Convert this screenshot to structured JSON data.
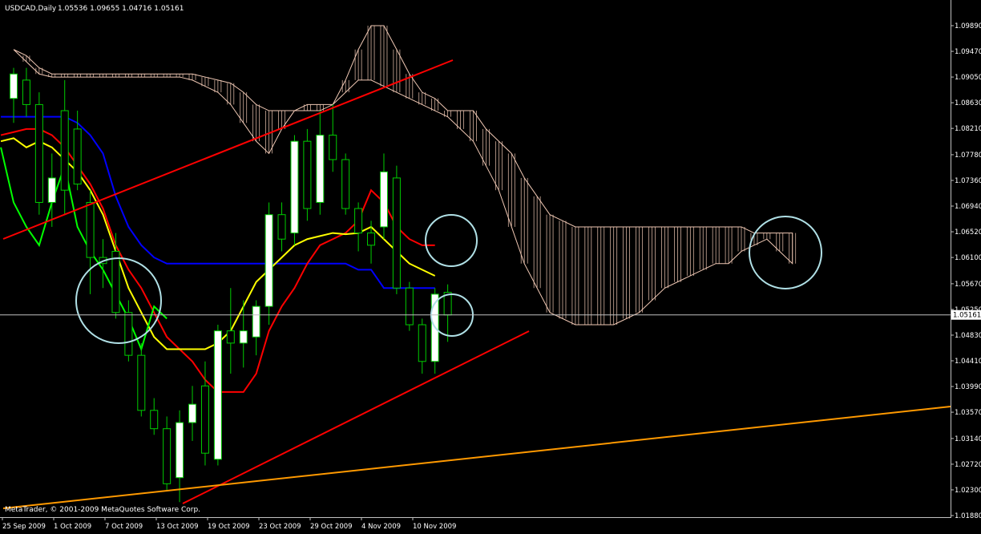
{
  "header": {
    "symbol_tf": "USDCAD,Daily",
    "ohlc": "1.05536 1.09655 1.04716 1.05161"
  },
  "copyright": "MetaTrader, © 2001-2009 MetaQuotes Software Corp.",
  "colors": {
    "background": "#000000",
    "axis": "#c0c0c0",
    "bull_body": "#ffffff",
    "candle_outline": "#00cc00",
    "tenkan": "#ffff00",
    "kijun": "#ff0000",
    "senkou_b": "#0000ff",
    "chikou": "#00ff00",
    "kumo": "#f0c8b4",
    "trendline_red": "#ff0000",
    "trendline_orange": "#ff9900",
    "circle": "#b0e0e6",
    "current_price_line": "#c0c0c0"
  },
  "chart_data": {
    "type": "candlestick",
    "symbol": "USDCAD",
    "timeframe": "Daily",
    "y_axis_ticks": [
      "1.09890",
      "1.09470",
      "1.09050",
      "1.08630",
      "1.08210",
      "1.07780",
      "1.07360",
      "1.06940",
      "1.06520",
      "1.06100",
      "1.05670",
      "1.05250",
      "1.04830",
      "1.04410",
      "1.03990",
      "1.03570",
      "1.03140",
      "1.02720",
      "1.02300",
      "1.01880"
    ],
    "ylim": [
      1.0188,
      1.0989
    ],
    "current_price": "1.05161",
    "x_axis_labels": [
      "25 Sep 2009",
      "1 Oct 2009",
      "7 Oct 2009",
      "13 Oct 2009",
      "19 Oct 2009",
      "23 Oct 2009",
      "29 Oct 2009",
      "4 Nov 2009",
      "10 Nov 2009"
    ],
    "candles": [
      {
        "o": 1.087,
        "h": 1.092,
        "l": 1.083,
        "c": 1.091
      },
      {
        "o": 1.09,
        "h": 1.092,
        "l": 1.084,
        "c": 1.086
      },
      {
        "o": 1.086,
        "h": 1.088,
        "l": 1.068,
        "c": 1.07
      },
      {
        "o": 1.07,
        "h": 1.078,
        "l": 1.066,
        "c": 1.074
      },
      {
        "o": 1.085,
        "h": 1.09,
        "l": 1.068,
        "c": 1.072
      },
      {
        "o": 1.082,
        "h": 1.085,
        "l": 1.072,
        "c": 1.073
      },
      {
        "o": 1.07,
        "h": 1.072,
        "l": 1.055,
        "c": 1.061
      },
      {
        "o": 1.061,
        "h": 1.064,
        "l": 1.056,
        "c": 1.06
      },
      {
        "o": 1.062,
        "h": 1.065,
        "l": 1.051,
        "c": 1.052
      },
      {
        "o": 1.052,
        "h": 1.054,
        "l": 1.044,
        "c": 1.045
      },
      {
        "o": 1.045,
        "h": 1.047,
        "l": 1.035,
        "c": 1.036
      },
      {
        "o": 1.036,
        "h": 1.038,
        "l": 1.032,
        "c": 1.033
      },
      {
        "o": 1.033,
        "h": 1.035,
        "l": 1.023,
        "c": 1.024
      },
      {
        "o": 1.025,
        "h": 1.036,
        "l": 1.021,
        "c": 1.034
      },
      {
        "o": 1.034,
        "h": 1.04,
        "l": 1.031,
        "c": 1.037
      },
      {
        "o": 1.04,
        "h": 1.044,
        "l": 1.027,
        "c": 1.029
      },
      {
        "o": 1.028,
        "h": 1.05,
        "l": 1.027,
        "c": 1.049
      },
      {
        "o": 1.049,
        "h": 1.056,
        "l": 1.042,
        "c": 1.047
      },
      {
        "o": 1.047,
        "h": 1.054,
        "l": 1.043,
        "c": 1.049
      },
      {
        "o": 1.048,
        "h": 1.054,
        "l": 1.045,
        "c": 1.053
      },
      {
        "o": 1.053,
        "h": 1.07,
        "l": 1.05,
        "c": 1.068
      },
      {
        "o": 1.068,
        "h": 1.07,
        "l": 1.062,
        "c": 1.064
      },
      {
        "o": 1.065,
        "h": 1.081,
        "l": 1.063,
        "c": 1.08
      },
      {
        "o": 1.08,
        "h": 1.082,
        "l": 1.067,
        "c": 1.069
      },
      {
        "o": 1.07,
        "h": 1.085,
        "l": 1.068,
        "c": 1.081
      },
      {
        "o": 1.081,
        "h": 1.086,
        "l": 1.075,
        "c": 1.077
      },
      {
        "o": 1.077,
        "h": 1.078,
        "l": 1.068,
        "c": 1.069
      },
      {
        "o": 1.069,
        "h": 1.07,
        "l": 1.062,
        "c": 1.065
      },
      {
        "o": 1.065,
        "h": 1.067,
        "l": 1.06,
        "c": 1.063
      },
      {
        "o": 1.066,
        "h": 1.078,
        "l": 1.064,
        "c": 1.075
      },
      {
        "o": 1.074,
        "h": 1.076,
        "l": 1.055,
        "c": 1.056
      },
      {
        "o": 1.056,
        "h": 1.057,
        "l": 1.049,
        "c": 1.05
      },
      {
        "o": 1.05,
        "h": 1.051,
        "l": 1.042,
        "c": 1.044
      },
      {
        "o": 1.044,
        "h": 1.056,
        "l": 1.042,
        "c": 1.055
      },
      {
        "o": 1.0553,
        "h": 1.0566,
        "l": 1.0472,
        "c": 1.0516
      }
    ],
    "tenkan": [
      1.08,
      1.0805,
      1.079,
      1.08,
      1.079,
      1.077,
      1.075,
      1.072,
      1.068,
      1.062,
      1.056,
      1.052,
      1.048,
      1.046,
      1.046,
      1.046,
      1.046,
      1.047,
      1.049,
      1.053,
      1.057,
      1.059,
      1.061,
      1.063,
      1.064,
      1.0645,
      1.065,
      1.0648,
      1.065,
      1.066,
      1.064,
      1.062,
      1.06,
      1.059,
      1.058
    ],
    "kijun": [
      1.081,
      1.0815,
      1.082,
      1.082,
      1.081,
      1.079,
      1.076,
      1.073,
      1.069,
      1.063,
      1.059,
      1.056,
      1.052,
      1.048,
      1.046,
      1.044,
      1.041,
      1.039,
      1.039,
      1.039,
      1.042,
      1.049,
      1.053,
      1.056,
      1.06,
      1.063,
      1.064,
      1.065,
      1.067,
      1.072,
      1.07,
      1.066,
      1.064,
      1.063,
      1.063
    ],
    "senkou_b_line": [
      1.084,
      1.084,
      1.084,
      1.084,
      1.084,
      1.084,
      1.083,
      1.081,
      1.078,
      1.071,
      1.066,
      1.063,
      1.061,
      1.06,
      1.06,
      1.06,
      1.06,
      1.06,
      1.06,
      1.06,
      1.06,
      1.06,
      1.06,
      1.06,
      1.06,
      1.06,
      1.06,
      1.06,
      1.059,
      1.059,
      1.056,
      1.056,
      1.056,
      1.056,
      1.056
    ],
    "chikou": [
      1.079,
      1.07,
      1.066,
      1.063,
      1.07,
      1.076,
      1.066,
      1.062,
      1.059,
      1.055,
      1.051,
      1.046,
      1.053,
      1.051
    ],
    "kumo_upper": [
      1.095,
      1.094,
      1.092,
      1.091,
      1.091,
      1.091,
      1.091,
      1.091,
      1.091,
      1.091,
      1.091,
      1.091,
      1.091,
      1.091,
      1.091,
      1.0905,
      1.09,
      1.0895,
      1.088,
      1.086,
      1.085,
      1.085,
      1.085,
      1.085,
      1.085,
      1.086,
      1.09,
      1.095,
      1.0989,
      1.0989,
      1.095,
      1.091,
      1.088,
      1.087,
      1.085,
      1.085,
      1.085,
      1.082,
      1.08,
      1.078,
      1.074,
      1.071,
      1.068,
      1.067,
      1.066,
      1.066,
      1.066,
      1.066,
      1.066,
      1.066,
      1.066,
      1.066,
      1.066,
      1.066,
      1.066,
      1.066,
      1.066,
      1.066,
      1.065,
      1.065,
      1.065,
      1.065
    ],
    "kumo_lower": [
      1.095,
      1.093,
      1.091,
      1.0905,
      1.0905,
      1.0905,
      1.0905,
      1.0905,
      1.0905,
      1.0905,
      1.0905,
      1.0905,
      1.0905,
      1.0905,
      1.09,
      1.089,
      1.088,
      1.086,
      1.083,
      1.08,
      1.078,
      1.082,
      1.085,
      1.086,
      1.086,
      1.086,
      1.088,
      1.09,
      1.09,
      1.089,
      1.088,
      1.087,
      1.086,
      1.085,
      1.084,
      1.082,
      1.08,
      1.076,
      1.072,
      1.066,
      1.06,
      1.056,
      1.052,
      1.051,
      1.05,
      1.05,
      1.05,
      1.05,
      1.051,
      1.052,
      1.054,
      1.056,
      1.057,
      1.058,
      1.059,
      1.06,
      1.06,
      1.062,
      1.063,
      1.064,
      1.062,
      1.06
    ]
  }
}
